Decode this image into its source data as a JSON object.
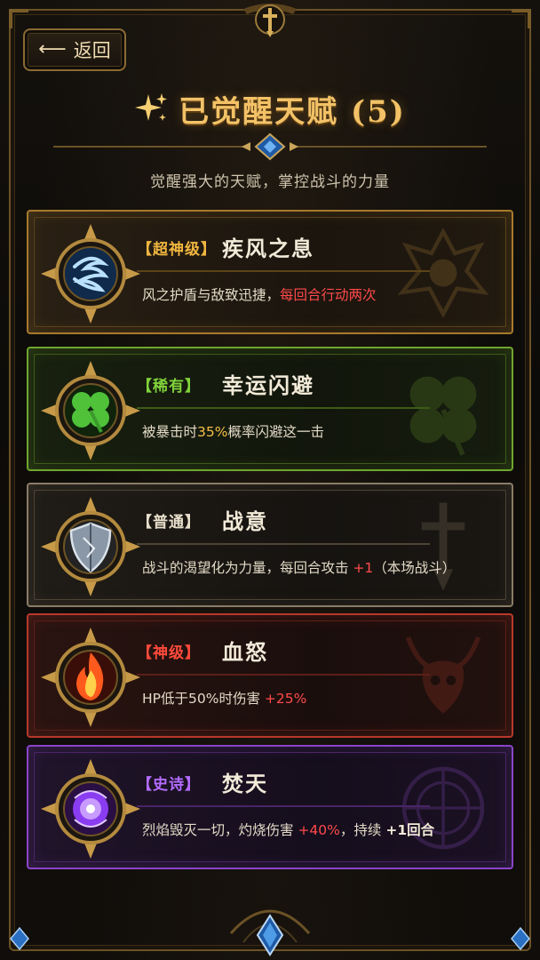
{
  "header": {
    "back_label": "返回",
    "title": "已觉醒天赋 (5)",
    "subtitle": "觉醒强大的天赋，掌控战斗的力量"
  },
  "talents": [
    {
      "tier": "【超神级】",
      "name": "疾风之息",
      "desc_plain": "风之护盾与敌致迅捷，",
      "desc_highlight": "每回合行动两次",
      "icon": "wind-icon",
      "watermark": "demon-crest-icon",
      "theme_color": "#c9952f",
      "tier_color": "#f0b640"
    },
    {
      "tier": "【稀有】",
      "name": "幸运闪避",
      "desc_pre": "被暴击时",
      "desc_highlight": "35%",
      "desc_post": "概率闪避这一击",
      "icon": "clover-icon",
      "watermark": "clover-icon",
      "theme_color": "#6fa52e",
      "tier_color": "#7fd23a"
    },
    {
      "tier": "【普通】",
      "name": "战意",
      "desc_pre": "战斗的渴望化为力量，每回合攻击 ",
      "desc_highlight": "+1",
      "desc_post": "（本场战斗）",
      "icon": "shield-icon",
      "watermark": "sword-icon",
      "theme_color": "#8a7c66",
      "tier_color": "#e8dfcc"
    },
    {
      "tier": "【神级】",
      "name": "血怒",
      "desc_pre": "HP低于50%时伤害 ",
      "desc_highlight": "+25%",
      "icon": "flame-icon",
      "watermark": "demon-skull-icon",
      "theme_color": "#b8382a",
      "tier_color": "#ff4a3a"
    },
    {
      "tier": "【史诗】",
      "name": "焚天",
      "desc_pre": "烈焰毁灭一切，灼烧伤害 ",
      "desc_highlight": "+40%",
      "desc_mid": "，持续 ",
      "desc_highlight2": "+1回合",
      "icon": "arcane-orb-icon",
      "watermark": "rune-circle-icon",
      "theme_color": "#8a44c8",
      "tier_color": "#b46cff"
    }
  ]
}
